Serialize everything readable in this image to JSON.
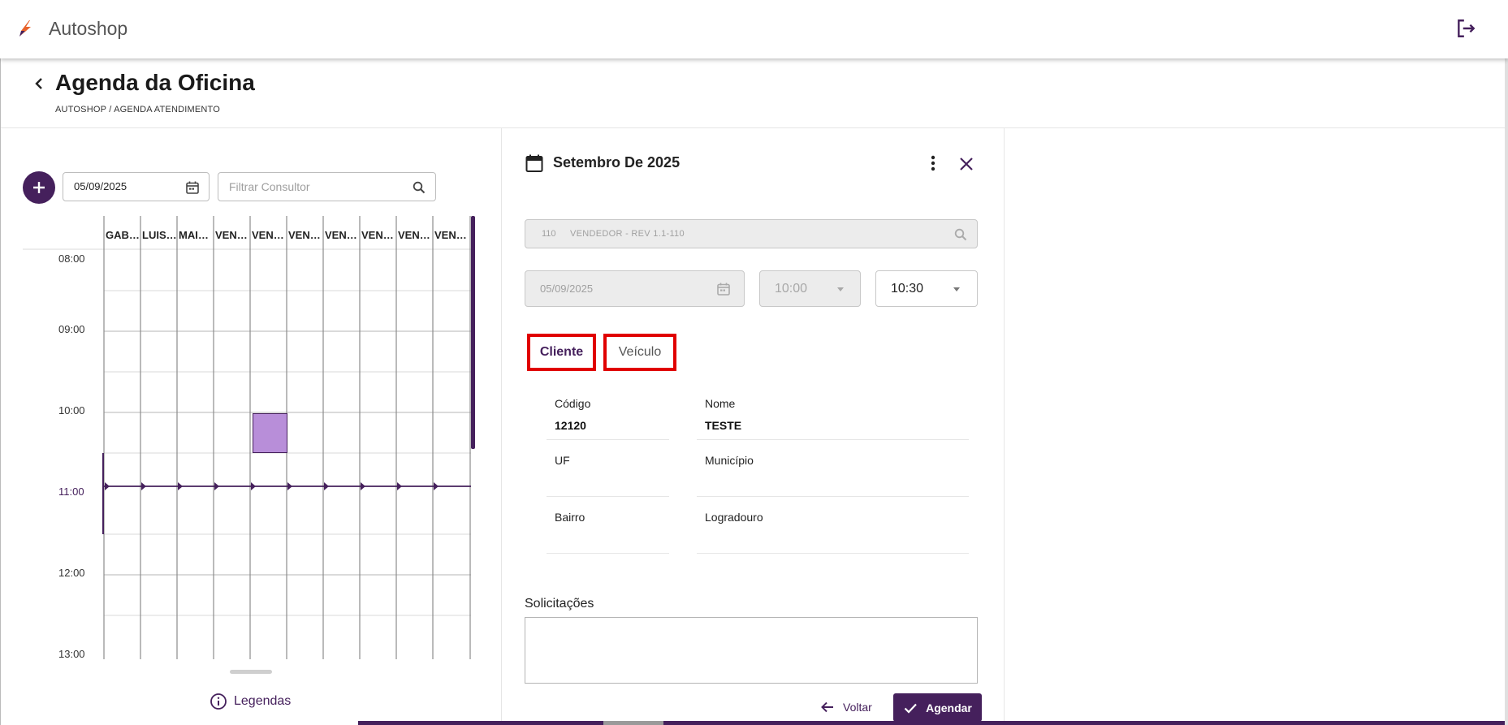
{
  "app": {
    "name": "Autoshop",
    "accent": "#45205c"
  },
  "page": {
    "title": "Agenda da Oficina",
    "breadcrumb": "AUTOSHOP / AGENDA ATENDIMENTO"
  },
  "scheduler": {
    "date_value": "05/09/2025",
    "filter_placeholder": "Filtrar Consultor",
    "columns": [
      "GABRIEL",
      "LUIS",
      "MAIARA",
      "VENDEDOR",
      "VENDEDOR",
      "VENDEDOR",
      "VENDEDOR",
      "VENDEDOR",
      "VENDEDOR",
      "VENDEDOR"
    ],
    "column_labels": [
      "GAB…",
      "LUIS …",
      "MAI…",
      "VEN…",
      "VEN…",
      "VEN…",
      "VEN…",
      "VEN…",
      "VEN…",
      "VEN…"
    ],
    "times": [
      "08:00",
      "09:00",
      "10:00",
      "11:00",
      "12:00",
      "13:00"
    ],
    "current_time": "11:00",
    "legend_label": "Legendas",
    "event_color": "#b88ed9"
  },
  "panel": {
    "title": "Setembro De 2025",
    "vendor_code": "110",
    "vendor_name": "VENDEDOR - REV 1.1-110",
    "date": "05/09/2025",
    "start_time": "10:00",
    "end_time": "10:30",
    "tabs": {
      "cliente": "Cliente",
      "veiculo": "Veículo"
    },
    "client": {
      "codigo_label": "Código",
      "codigo_value": "12120",
      "nome_label": "Nome",
      "nome_value": "TESTE",
      "uf_label": "UF",
      "uf_value": "",
      "municipio_label": "Município",
      "municipio_value": "",
      "bairro_label": "Bairro",
      "bairro_value": "",
      "logradouro_label": "Logradouro",
      "logradouro_value": ""
    },
    "solicitacoes_label": "Solicitações",
    "solicitacoes_value": "",
    "back_label": "Voltar",
    "schedule_label": "Agendar"
  }
}
